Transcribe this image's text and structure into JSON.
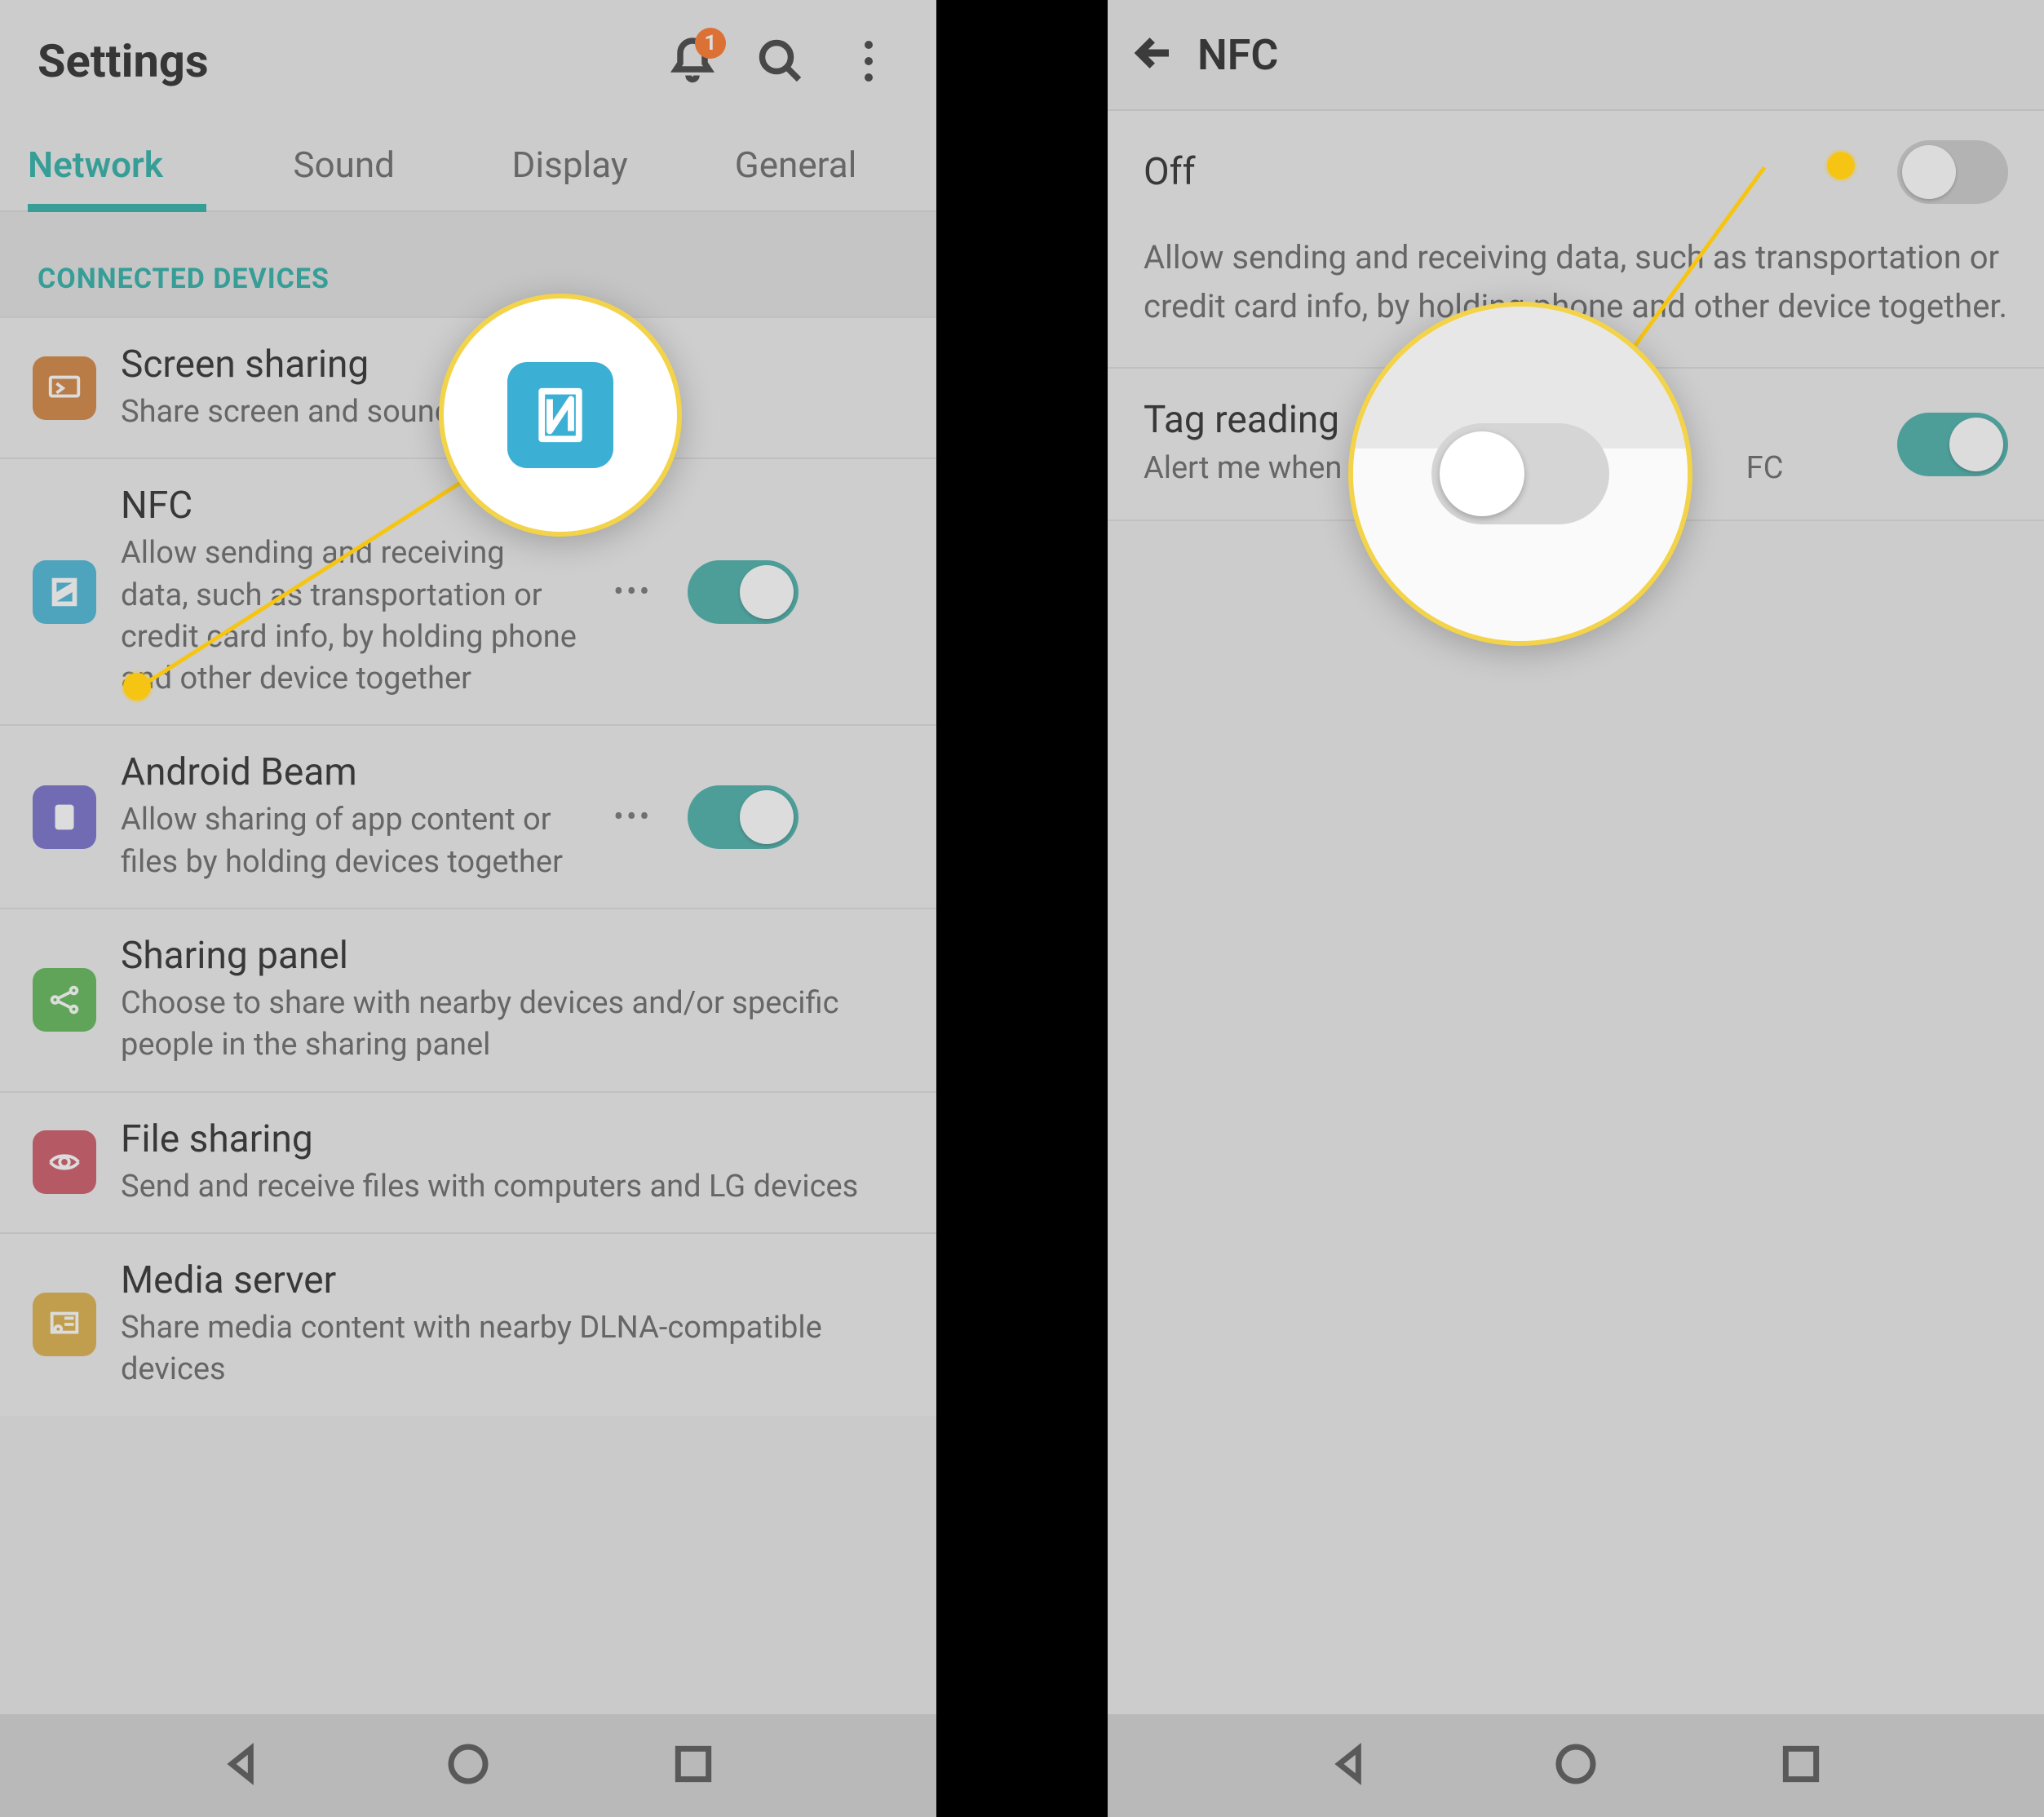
{
  "left": {
    "header_title": "Settings",
    "notification_badge": "1",
    "tabs": [
      "Network",
      "Sound",
      "Display",
      "General"
    ],
    "active_tab_index": 0,
    "section_header": "CONNECTED DEVICES",
    "rows": {
      "screen_sharing": {
        "title": "Screen sharing",
        "sub": "Share screen and sound with"
      },
      "nfc": {
        "title": "NFC",
        "sub": "Allow sending and receiving data, such as transportation or credit card info, by holding phone and other device together",
        "more": "•••"
      },
      "android_beam": {
        "title": "Android Beam",
        "sub": "Allow sharing of app content or files by holding devices together",
        "more": "•••"
      },
      "sharing_panel": {
        "title": "Sharing panel",
        "sub": "Choose to share with nearby devices and/or specific people in the sharing panel"
      },
      "file_sharing": {
        "title": "File sharing",
        "sub": "Send and receive files with computers and LG devices"
      },
      "media_server": {
        "title": "Media server",
        "sub": "Share media content with nearby DLNA-compatible devices"
      }
    }
  },
  "right": {
    "header_title": "NFC",
    "off_label": "Off",
    "description": "Allow sending and receiving data, such as transportation or credit card info, by holding phone and other device together.",
    "tag_reading_label": "Tag reading",
    "tag_reading_sub_full": "Alert me when my phone reads an NFC tag",
    "tag_reading_sub_visible_left": "Alert me when",
    "tag_reading_sub_visible_right": "FC"
  },
  "colors": {
    "accent": "#1aa9a0",
    "toggle_on": "#3aa9a2",
    "callout_ring": "#f3d34a",
    "anchor": "#f6c514",
    "badge": "#ff6b1a"
  }
}
